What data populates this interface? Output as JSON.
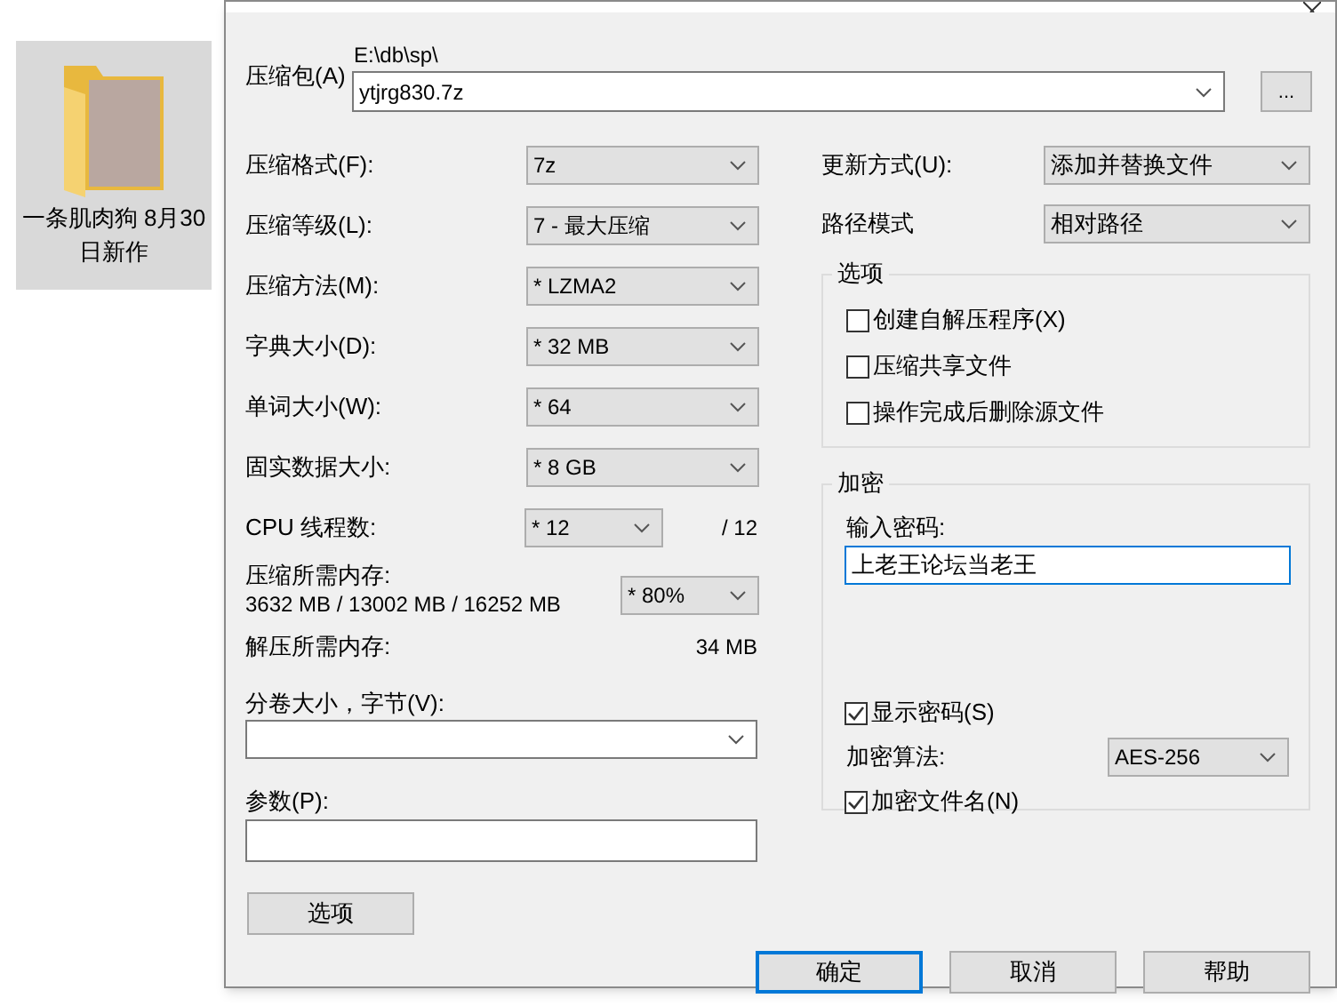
{
  "desktop_item": {
    "label": "一条肌肉狗 8月30日新作",
    "selected": true
  },
  "dialog": {
    "archive": {
      "label": "压缩包(A)",
      "path": "E:\\db\\sp\\",
      "value": "ytjrg830.7z",
      "browse_button": "..."
    },
    "left_fields": [
      {
        "kind": "select",
        "label": "压缩格式(F):",
        "value": "7z"
      },
      {
        "kind": "select",
        "label": "压缩等级(L):",
        "value": "7 - 最大压缩"
      },
      {
        "kind": "select",
        "label": "压缩方法(M):",
        "value": "* LZMA2"
      },
      {
        "kind": "select",
        "label": "字典大小(D):",
        "value": "* 32 MB"
      },
      {
        "kind": "select",
        "label": "单词大小(W):",
        "value": "* 64"
      },
      {
        "kind": "select",
        "label": "固实数据大小:",
        "value": "* 8 GB"
      },
      {
        "kind": "threads",
        "label": "CPU 线程数:",
        "value": "* 12",
        "suffix": "/ 12"
      },
      {
        "kind": "memory",
        "label": "压缩所需内存:",
        "detail": "3632 MB / 13002 MB / 16252 MB",
        "value": "* 80%"
      },
      {
        "kind": "info",
        "label": "解压所需内存:",
        "value": "34 MB"
      }
    ],
    "volume": {
      "label": "分卷大小，字节(V):"
    },
    "params": {
      "label": "参数(P):"
    },
    "options_button": "选项",
    "right_fields": [
      {
        "label": "更新方式(U):",
        "value": "添加并替换文件"
      },
      {
        "label": "路径模式",
        "value": "相对路径"
      }
    ],
    "options_group": {
      "title": "选项",
      "checkboxes": [
        {
          "label": "创建自解压程序(X)",
          "checked": false
        },
        {
          "label": "压缩共享文件",
          "checked": false
        },
        {
          "label": "操作完成后删除源文件",
          "checked": false
        }
      ]
    },
    "encryption": {
      "title": "加密",
      "password_label": "输入密码:",
      "password": "上老王论坛当老王",
      "show_password": {
        "label": "显示密码(S)",
        "checked": true
      },
      "method_label": "加密算法:",
      "method": "AES-256",
      "encrypt_names": {
        "label": "加密文件名(N)",
        "checked": true
      }
    },
    "buttons": [
      {
        "label": "确定",
        "default": true
      },
      {
        "label": "取消",
        "default": false
      },
      {
        "label": "帮助",
        "default": false
      }
    ]
  }
}
